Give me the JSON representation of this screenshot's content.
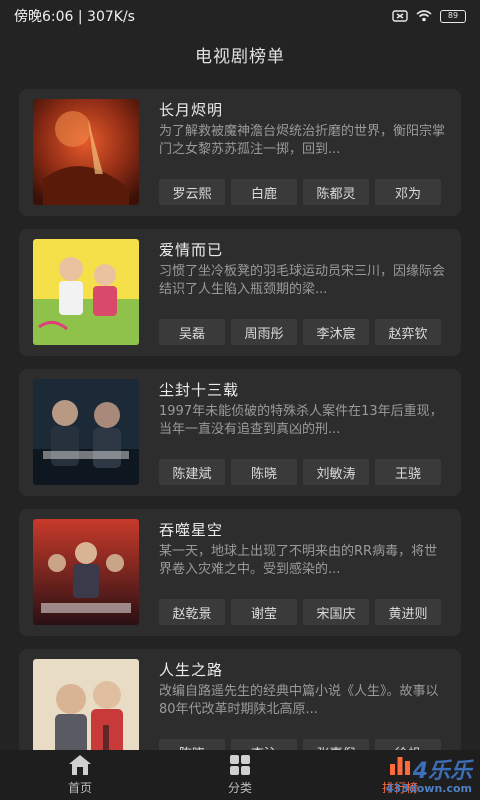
{
  "status_bar": {
    "time": "傍晚6:06 | 307K/s",
    "battery": "89"
  },
  "header": {
    "title": "电视剧榜单"
  },
  "dramas": [
    {
      "title": "长月烬明",
      "desc": "为了解救被魔神澹台烬统治折磨的世界，衡阳宗掌门之女黎苏苏孤注一掷，回到...",
      "cast": [
        "罗云熙",
        "白鹿",
        "陈都灵",
        "邓为"
      ]
    },
    {
      "title": "爱情而已",
      "desc": "习惯了坐冷板凳的羽毛球运动员宋三川，因缘际会结识了人生陷入瓶颈期的梁...",
      "cast": [
        "吴磊",
        "周雨彤",
        "李沐宸",
        "赵弈钦"
      ]
    },
    {
      "title": "尘封十三载",
      "desc": "1997年未能侦破的特殊杀人案件在13年后重现，当年一直没有追查到真凶的刑...",
      "cast": [
        "陈建斌",
        "陈晓",
        "刘敏涛",
        "王骁"
      ]
    },
    {
      "title": "吞噬星空",
      "desc": "某一天，地球上出现了不明来由的RR病毒，将世界卷入灾难之中。受到感染的...",
      "cast": [
        "赵乾景",
        "谢莹",
        "宋国庆",
        "黄进则"
      ]
    },
    {
      "title": "人生之路",
      "desc": "改编自路遥先生的经典中篇小说《人生》。故事以80年代改革时期陕北高原...",
      "cast": [
        "陈晓",
        "李沁",
        "张嘉倪",
        "徐帆"
      ]
    }
  ],
  "tabbar": {
    "tabs": [
      {
        "label": "首页",
        "icon": "home-icon"
      },
      {
        "label": "分类",
        "icon": "grid-icon"
      },
      {
        "label": "排行榜",
        "icon": "ranking-icon"
      }
    ],
    "active_color": "#ff6a3a"
  },
  "watermark": {
    "big": "4乐乐",
    "small": "433down.com"
  }
}
